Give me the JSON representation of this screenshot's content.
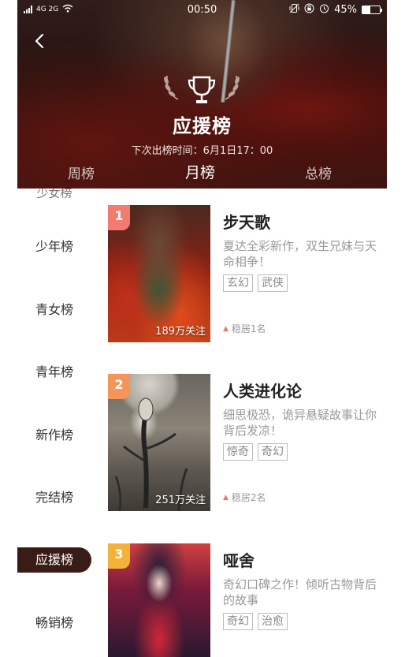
{
  "status_bar": {
    "signal_text": "4G 2G",
    "time": "00:50",
    "battery": "45%",
    "battery_fill_fraction": 0.45
  },
  "header": {
    "title": "应援榜",
    "next_time": "下次出榜时间：6月1日17：00",
    "tabs": [
      {
        "label": "周榜",
        "active": false
      },
      {
        "label": "月榜",
        "active": true
      },
      {
        "label": "总榜",
        "active": false
      }
    ]
  },
  "sidebar": {
    "items": [
      {
        "label": "少女榜",
        "active": false
      },
      {
        "label": "少年榜",
        "active": false
      },
      {
        "label": "青女榜",
        "active": false
      },
      {
        "label": "青年榜",
        "active": false
      },
      {
        "label": "新作榜",
        "active": false
      },
      {
        "label": "完结榜",
        "active": false
      },
      {
        "label": "应援榜",
        "active": true
      },
      {
        "label": "畅销榜",
        "active": false
      }
    ]
  },
  "list": [
    {
      "rank": "1",
      "title": "步天歌",
      "desc": "夏达全彩新作，双生兄妹与天命相争！",
      "tags": [
        "玄幻",
        "武侠"
      ],
      "followers": "189万关注",
      "stay": "稳居1名",
      "badge_color": "#f27a6e"
    },
    {
      "rank": "2",
      "title": "人类进化论",
      "desc": "细思极恐，诡异悬疑故事让你背后发凉！",
      "tags": [
        "惊奇",
        "奇幻"
      ],
      "followers": "251万关注",
      "stay": "稳居2名",
      "badge_color": "#f5955a"
    },
    {
      "rank": "3",
      "title": "哑舍",
      "desc": "奇幻口碑之作！倾听古物背后的故事",
      "tags": [
        "奇幻",
        "治愈"
      ],
      "followers": "",
      "stay": "",
      "badge_color": "#f5b23a"
    }
  ],
  "colors": {
    "header_dark": "#2a1614",
    "active_sidebar": "#3a1c16",
    "stay_icon": "#e57a6b"
  }
}
